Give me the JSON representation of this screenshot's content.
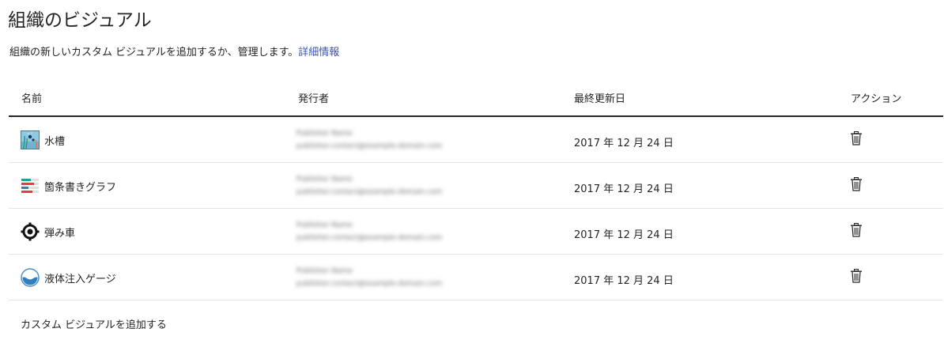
{
  "page": {
    "title": "組織のビジュアル",
    "description": "組織の新しいカスタム ビジュアルを追加するか、管理します。",
    "learn_more": "詳細情報"
  },
  "table": {
    "columns": {
      "name": "名前",
      "publisher": "発行者",
      "last_updated": "最終更新日",
      "action": "アクション"
    },
    "rows": [
      {
        "name": "水槽",
        "icon": "aquarium-icon",
        "publisher_line1": "",
        "publisher_line2": "",
        "date": "2017 年 12 月 24 日",
        "action_icon": "trash-icon"
      },
      {
        "name": "箇条書きグラフ",
        "icon": "bullet-chart-icon",
        "publisher_line1": "",
        "publisher_line2": "",
        "date": "2017 年 12 月 24 日",
        "action_icon": "trash-icon"
      },
      {
        "name": "弾み車",
        "icon": "flywheel-icon",
        "publisher_line1": "",
        "publisher_line2": "",
        "date": "2017 年 12 月 24 日",
        "action_icon": "trash-icon"
      },
      {
        "name": "液体注入ゲージ",
        "icon": "liquid-fill-gauge-icon",
        "publisher_line1": "",
        "publisher_line2": "",
        "date": "2017 年 12 月 24 日",
        "action_icon": "trash-icon"
      }
    ]
  },
  "footer": {
    "add_label": "カスタム ビジュアルを追加する"
  },
  "colors": {
    "link": "#3a56b5",
    "text": "#252423",
    "divider": "#e6e6e6"
  }
}
